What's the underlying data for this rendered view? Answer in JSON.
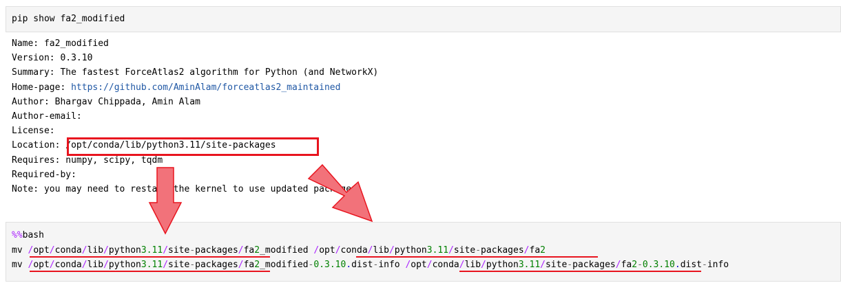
{
  "cell1": {
    "command": "pip show fa2_modified"
  },
  "output": {
    "name_label": "Name:",
    "name_value": "fa2_modified",
    "version_label": "Version:",
    "version_value": "0.3.10",
    "summary_label": "Summary:",
    "summary_value": "The fastest ForceAtlas2 algorithm for Python (and NetworkX)",
    "homepage_label": "Home-page:",
    "homepage_url": "https://github.com/AminAlam/forceatlas2_maintained",
    "author_label": "Author:",
    "author_value": "Bhargav Chippada, Amin Alam",
    "author_email_label": "Author-email:",
    "license_label": "License:",
    "location_label": "Location:",
    "location_value": "/opt/conda/lib/python3.11/site-packages",
    "requires_label": "Requires:",
    "requires_value": "numpy, scipy, tqdm",
    "required_by_label": "Required-by:",
    "note": "Note: you may need to restart the kernel to use updated packages."
  },
  "cell2": {
    "magic_prefix": "%%",
    "magic_name": "bash",
    "cmd": "mv",
    "line2": {
      "src_path": "/opt/conda/lib/python3.11/site-packages",
      "src_tail": "fa2_modified",
      "dst_path": "/opt/conda/lib/python3.11/site-packages",
      "dst_tail": "fa2"
    },
    "line3": {
      "src_path": "/opt/conda/lib/python3.11/site-packages",
      "src_tail": "fa2_modified-0.3.10.dist-info",
      "dst_path": "/opt/conda/lib/python3.11/site-packages",
      "dst_tail": "fa2-0.3.10.dist-info"
    }
  },
  "colors": {
    "highlight_red": "#e8141e",
    "arrow_fill": "#f2727a",
    "link_blue": "#1f57a4",
    "number_green": "#008000",
    "magic_purple": "#aa22ff"
  },
  "icons": {
    "arrow_down": "down-arrow-icon",
    "arrow_diagonal": "diagonal-arrow-icon"
  }
}
